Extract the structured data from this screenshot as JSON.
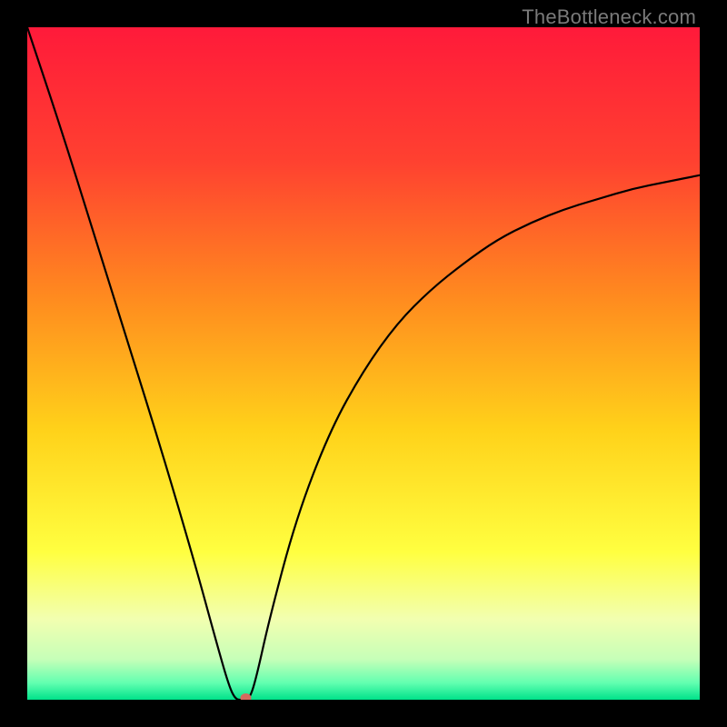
{
  "watermark": "TheBottleneck.com",
  "chart_data": {
    "type": "line",
    "title": "",
    "xlabel": "",
    "ylabel": "",
    "xlim": [
      0,
      100
    ],
    "ylim": [
      0,
      100
    ],
    "background_gradient": {
      "stops": [
        {
          "offset": 0.0,
          "color": "#ff1a3a"
        },
        {
          "offset": 0.2,
          "color": "#ff4130"
        },
        {
          "offset": 0.4,
          "color": "#ff8a1f"
        },
        {
          "offset": 0.6,
          "color": "#ffd21a"
        },
        {
          "offset": 0.78,
          "color": "#ffff40"
        },
        {
          "offset": 0.88,
          "color": "#f2ffb0"
        },
        {
          "offset": 0.94,
          "color": "#c6ffb8"
        },
        {
          "offset": 0.975,
          "color": "#62ffb0"
        },
        {
          "offset": 1.0,
          "color": "#00e28a"
        }
      ]
    },
    "series": [
      {
        "name": "curve",
        "x": [
          0,
          5,
          10,
          15,
          20,
          25,
          28,
          30,
          31,
          32,
          33,
          34,
          36,
          40,
          45,
          50,
          55,
          60,
          65,
          70,
          75,
          80,
          85,
          90,
          95,
          100
        ],
        "y": [
          100,
          85,
          69,
          53,
          37,
          20,
          9,
          2,
          0,
          0,
          0,
          3,
          12,
          27,
          40,
          49,
          56,
          61,
          65,
          68.5,
          71,
          73,
          74.5,
          76,
          77,
          78
        ]
      }
    ],
    "marker": {
      "x": 32.5,
      "y": 0,
      "color": "#d46a5e",
      "rx": 6,
      "ry": 5
    },
    "axes_visible": false,
    "grid": false,
    "frame_color": "#000000"
  }
}
